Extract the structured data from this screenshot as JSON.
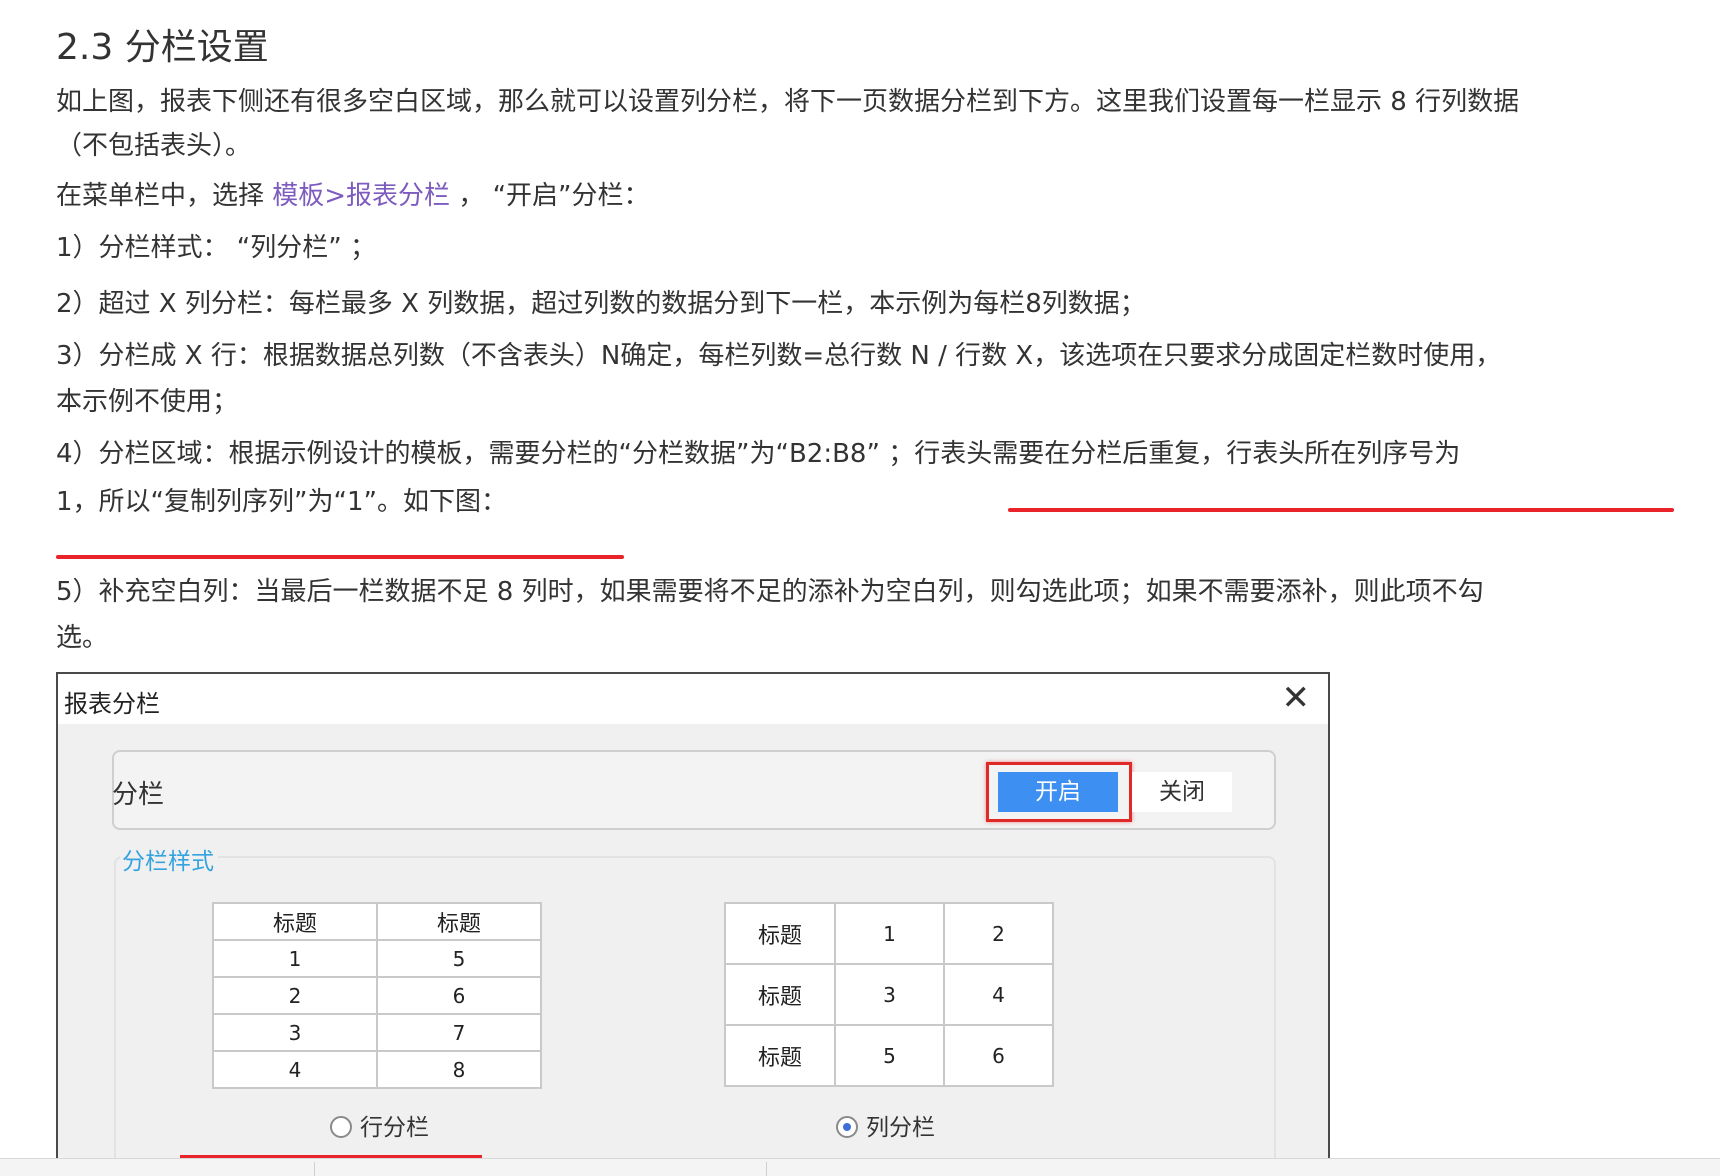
{
  "doc": {
    "title": "2.3 分栏设置",
    "p1_line1": "如上图，报表下侧还有很多空白区域，那么就可以设置列分栏，将下一页数据分栏到下方。这里我们设置每一栏显示 8 行列数据",
    "p1_line2": "（不包括表头）。",
    "p2_before": "在菜单栏中，选择 ",
    "p2_link": "模板>报表分栏",
    "p2_after": " ， “开启”分栏：",
    "item1": "1）分栏样式： “列分栏” ；",
    "item2": "2）超过 X 列分栏：每栏最多 X 列数据，超过列数的数据分到下一栏，本示例为每栏8列数据；",
    "item3_line1": "3）分栏成 X 行：根据数据总列数（不含表头）N确定，每栏列数=总行数 N / 行数 X，该选项在只要求分成固定栏数时使用，",
    "item3_line2": "本示例不使用；",
    "item4_line1": "4）分栏区域：根据示例设计的模板，需要分栏的“分栏数据”为“B2:B8” ；行表头需要在分栏后重复，行表头所在列序号为",
    "item4_line2": "1，所以“复制列序列”为“1”。如下图：",
    "item5_line1": "5）补充空白列：当最后一栏数据不足 8 列时，如果需要将不足的添补为空白列，则勾选此项；如果不需要添补，则此项不勾",
    "item5_line2": "选。"
  },
  "dialog": {
    "title": "报表分栏",
    "close_glyph": "✕",
    "toggle_label": "分栏",
    "toggle_on": "开启",
    "toggle_off": "关闭",
    "style_legend": "分栏样式",
    "row_table": [
      [
        "标题",
        "标题"
      ],
      [
        "1",
        "5"
      ],
      [
        "2",
        "6"
      ],
      [
        "3",
        "7"
      ],
      [
        "4",
        "8"
      ]
    ],
    "col_table": [
      [
        "标题",
        "1",
        "2"
      ],
      [
        "标题",
        "3",
        "4"
      ],
      [
        "标题",
        "5",
        "6"
      ]
    ],
    "radio_row": "行分栏",
    "radio_col": "列分栏",
    "selected_style": "列分栏"
  },
  "colors": {
    "link": "#7d5bbf",
    "underline": "#e8232a",
    "primary": "#3d8ff2",
    "legend": "#35a3e0"
  }
}
